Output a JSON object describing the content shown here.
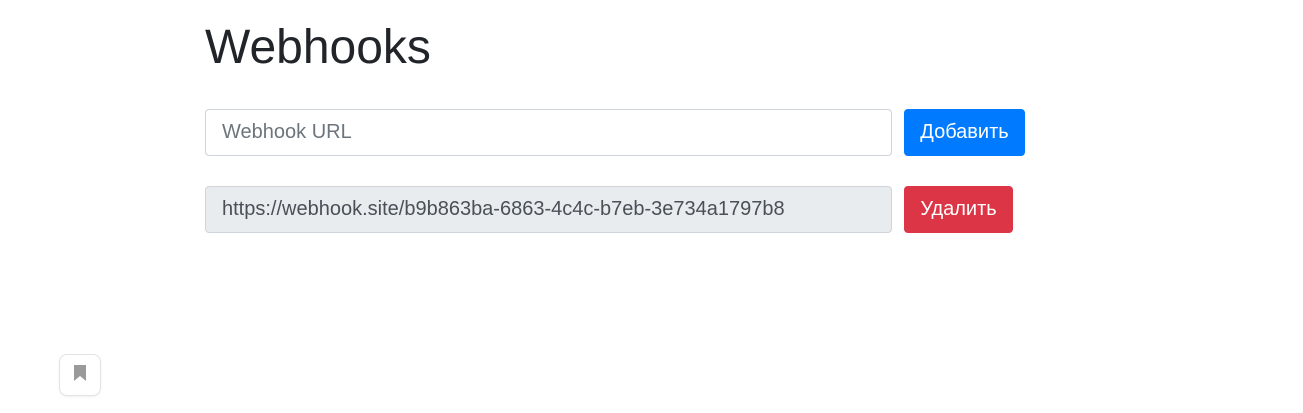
{
  "header": {
    "title": "Webhooks"
  },
  "add_form": {
    "url_placeholder": "Webhook URL",
    "url_value": "",
    "add_label": "Добавить"
  },
  "webhooks": [
    {
      "url": "https://webhook.site/b9b863ba-6863-4c4c-b7eb-3e734a1797b8",
      "delete_label": "Удалить"
    }
  ],
  "floating": {
    "bookmark_icon": "bookmark-icon"
  },
  "colors": {
    "primary": "#007bff",
    "danger": "#dc3545",
    "readonly_bg": "#e9ecef",
    "text": "#212529"
  }
}
